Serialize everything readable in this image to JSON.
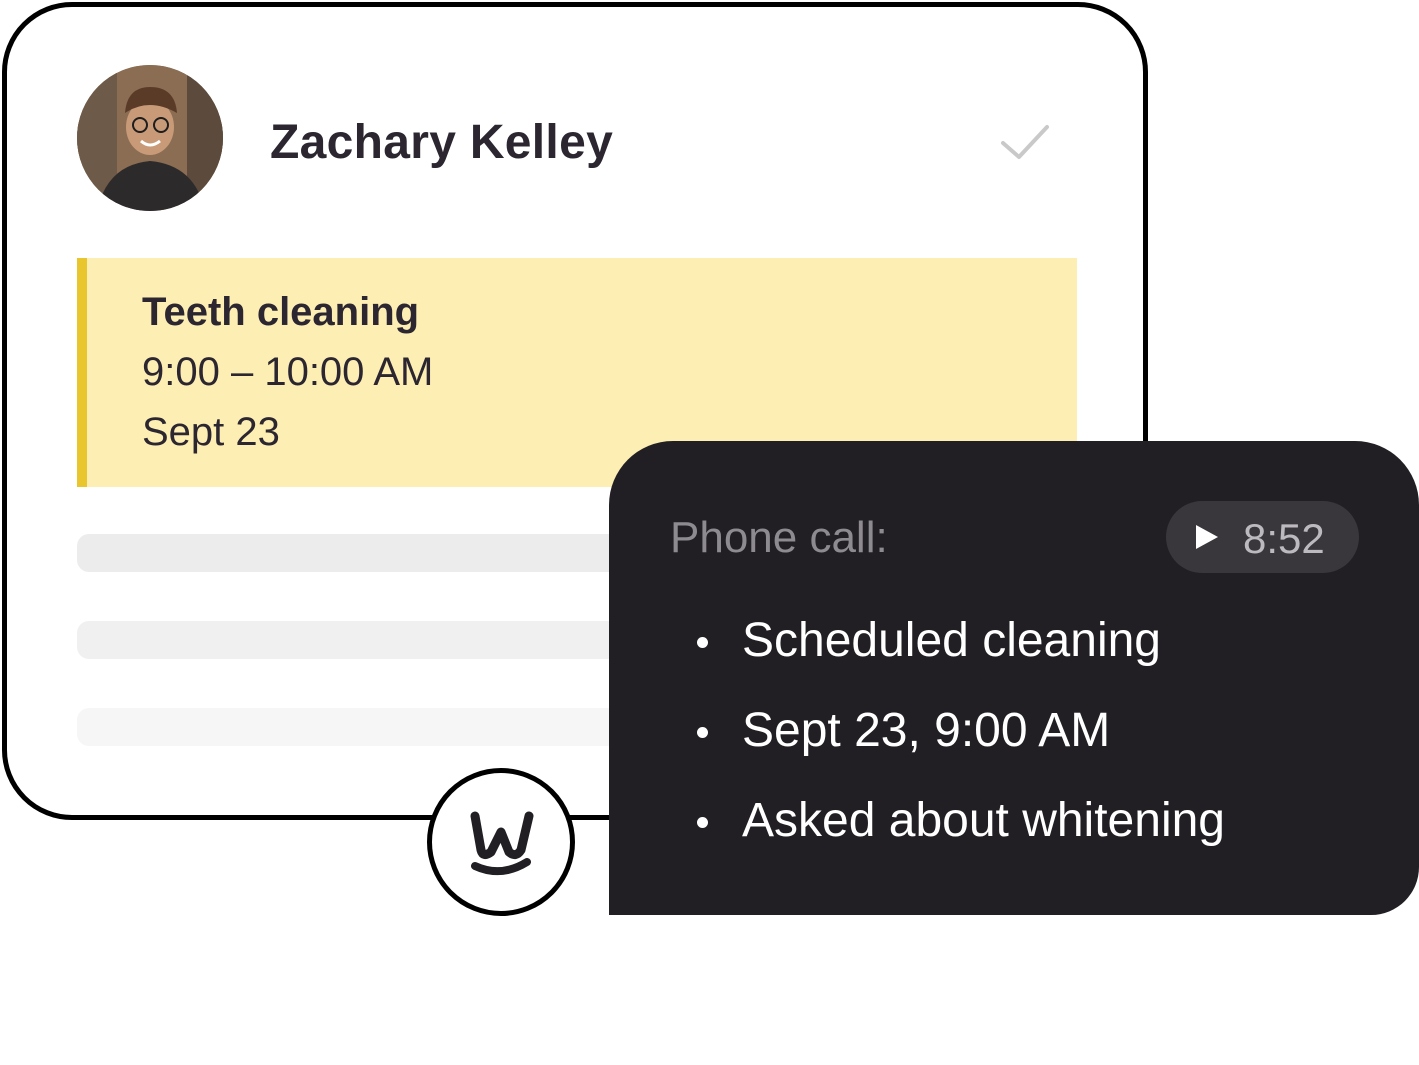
{
  "contact": {
    "name": "Zachary Kelley",
    "avatar_icon": "person-photo",
    "check_icon": "checkmark-icon"
  },
  "appointment": {
    "title": "Teeth cleaning",
    "time": "9:00 – 10:00 AM",
    "date": "Sept 23",
    "accent_color": "#e9c62d",
    "background_color": "#fdeeb3"
  },
  "call": {
    "label": "Phone call:",
    "duration": "8:52",
    "play_icon": "play-icon",
    "summary": [
      "Scheduled cleaning",
      "Sept 23, 9:00 AM",
      "Asked about whitening"
    ],
    "background_color": "#221f24"
  },
  "brand": {
    "logo_icon": "w-smile-logo"
  }
}
